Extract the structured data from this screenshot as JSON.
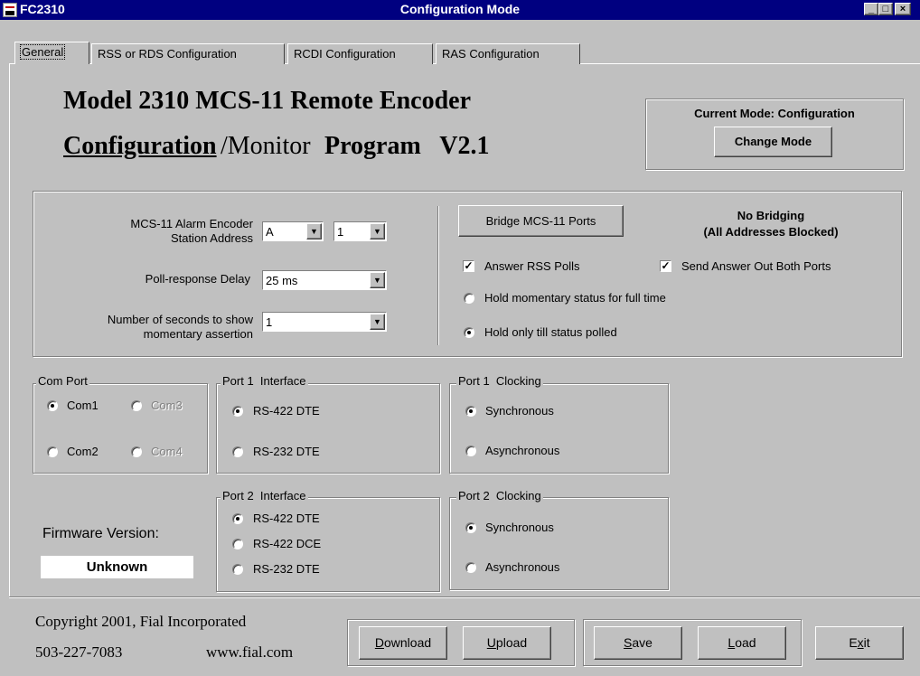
{
  "window": {
    "app_name": "FC2310",
    "title": "Configuration Mode",
    "controls": {
      "minimize": "_",
      "maximize": "□",
      "close": "×"
    }
  },
  "tabs": [
    {
      "label": "General",
      "active": true
    },
    {
      "label": "RSS or RDS Configuration",
      "active": false
    },
    {
      "label": "RCDI Configuration",
      "active": false
    },
    {
      "label": "RAS Configuration",
      "active": false
    }
  ],
  "heading": {
    "line1": "Model 2310 MCS-11 Remote Encoder",
    "line2_underlined": "Configuration",
    "line2_mid": "/Monitor ",
    "line2_bold": "Program   V2.1"
  },
  "mode": {
    "label": "Current Mode: Configuration",
    "button": "Change Mode"
  },
  "encoder": {
    "station_address_label_1": "MCS-11 Alarm Encoder",
    "station_address_label_2": "Station Address",
    "station_letter": "A",
    "station_number": "1",
    "poll_delay_label": "Poll-response Delay",
    "poll_delay_value": "25 ms",
    "momentary_label_1": "Number of seconds to show",
    "momentary_label_2": "momentary assertion",
    "momentary_value": "1"
  },
  "bridging": {
    "button": "Bridge MCS-11 Ports",
    "status_1": "No Bridging",
    "status_2": "(All Addresses Blocked)",
    "answer_rss": {
      "label": "Answer RSS Polls",
      "checked": true
    },
    "send_both": {
      "label": "Send Answer Out Both Ports",
      "checked": true
    },
    "hold_full": {
      "label": "Hold momentary status for full time",
      "selected": false
    },
    "hold_polled": {
      "label": "Hold only till status polled",
      "selected": true
    }
  },
  "com_port": {
    "title": "Com Port",
    "options": [
      {
        "label": "Com1",
        "selected": true,
        "enabled": true
      },
      {
        "label": "Com3",
        "selected": false,
        "enabled": false
      },
      {
        "label": "Com2",
        "selected": false,
        "enabled": true
      },
      {
        "label": "Com4",
        "selected": false,
        "enabled": false
      }
    ]
  },
  "port1_interface": {
    "title": "Port 1  Interface",
    "options": [
      {
        "label": "RS-422 DTE",
        "selected": true
      },
      {
        "label": "RS-232 DTE",
        "selected": false
      }
    ]
  },
  "port1_clocking": {
    "title": "Port 1  Clocking",
    "options": [
      {
        "label": "Synchronous",
        "selected": true
      },
      {
        "label": "Asynchronous",
        "selected": false
      }
    ]
  },
  "port2_interface": {
    "title": "Port 2  Interface",
    "options": [
      {
        "label": "RS-422 DTE",
        "selected": true
      },
      {
        "label": "RS-422 DCE",
        "selected": false
      },
      {
        "label": "RS-232 DTE",
        "selected": false
      }
    ]
  },
  "port2_clocking": {
    "title": "Port 2  Clocking",
    "options": [
      {
        "label": "Synchronous",
        "selected": true
      },
      {
        "label": "Asynchronous",
        "selected": false
      }
    ]
  },
  "firmware": {
    "label": "Firmware Version:",
    "value": "Unknown"
  },
  "footer": {
    "copyright": "Copyright 2001, Fial Incorporated",
    "phone": "503-227-7083",
    "website": "www.fial.com",
    "buttons": {
      "download": {
        "mnemonic": "D",
        "rest": "ownload"
      },
      "upload": {
        "mnemonic": "U",
        "rest": "pload"
      },
      "save": {
        "mnemonic": "S",
        "rest": "ave"
      },
      "load": {
        "mnemonic": "L",
        "rest": "oad"
      },
      "exit": {
        "pre": "E",
        "mnemonic": "x",
        "rest": "it"
      }
    }
  },
  "colors": {
    "titlebar": "#000080",
    "face": "#c0c0c0",
    "disabled_text": "#808080"
  }
}
